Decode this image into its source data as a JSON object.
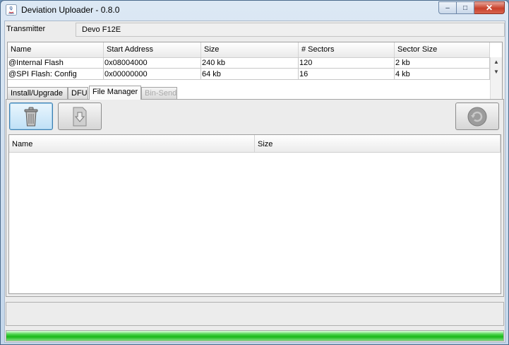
{
  "window": {
    "title": "Deviation Uploader - 0.8.0",
    "min_glyph": "–",
    "max_glyph": "□",
    "close_glyph": "✕"
  },
  "transmitter": {
    "label": "Transmitter",
    "value": "Devo F12E"
  },
  "memory_table": {
    "columns": [
      "Name",
      "Start Address",
      "Size",
      "# Sectors",
      "Sector Size"
    ],
    "rows": [
      [
        "@Internal Flash",
        "0x08004000",
        "240 kb",
        "120",
        "2 kb"
      ],
      [
        "@SPI Flash: Config",
        "0x00000000",
        "64 kb",
        "16",
        "4 kb"
      ]
    ],
    "scroll_up": "▲",
    "scroll_down": "▼"
  },
  "tabs": [
    {
      "label": "Install/Upgrade",
      "state": "normal"
    },
    {
      "label": "DFU",
      "state": "normal"
    },
    {
      "label": "File Manager",
      "state": "active"
    },
    {
      "label": "Bin-Send",
      "state": "disabled"
    }
  ],
  "toolbar": {
    "delete_icon": "trash-icon",
    "download_icon": "download-icon",
    "refresh_icon": "refresh-icon"
  },
  "file_table": {
    "columns": [
      "Name",
      "Size"
    ]
  },
  "status_text": "",
  "progress": {
    "fraction": 1.0,
    "color": "#22c022"
  }
}
